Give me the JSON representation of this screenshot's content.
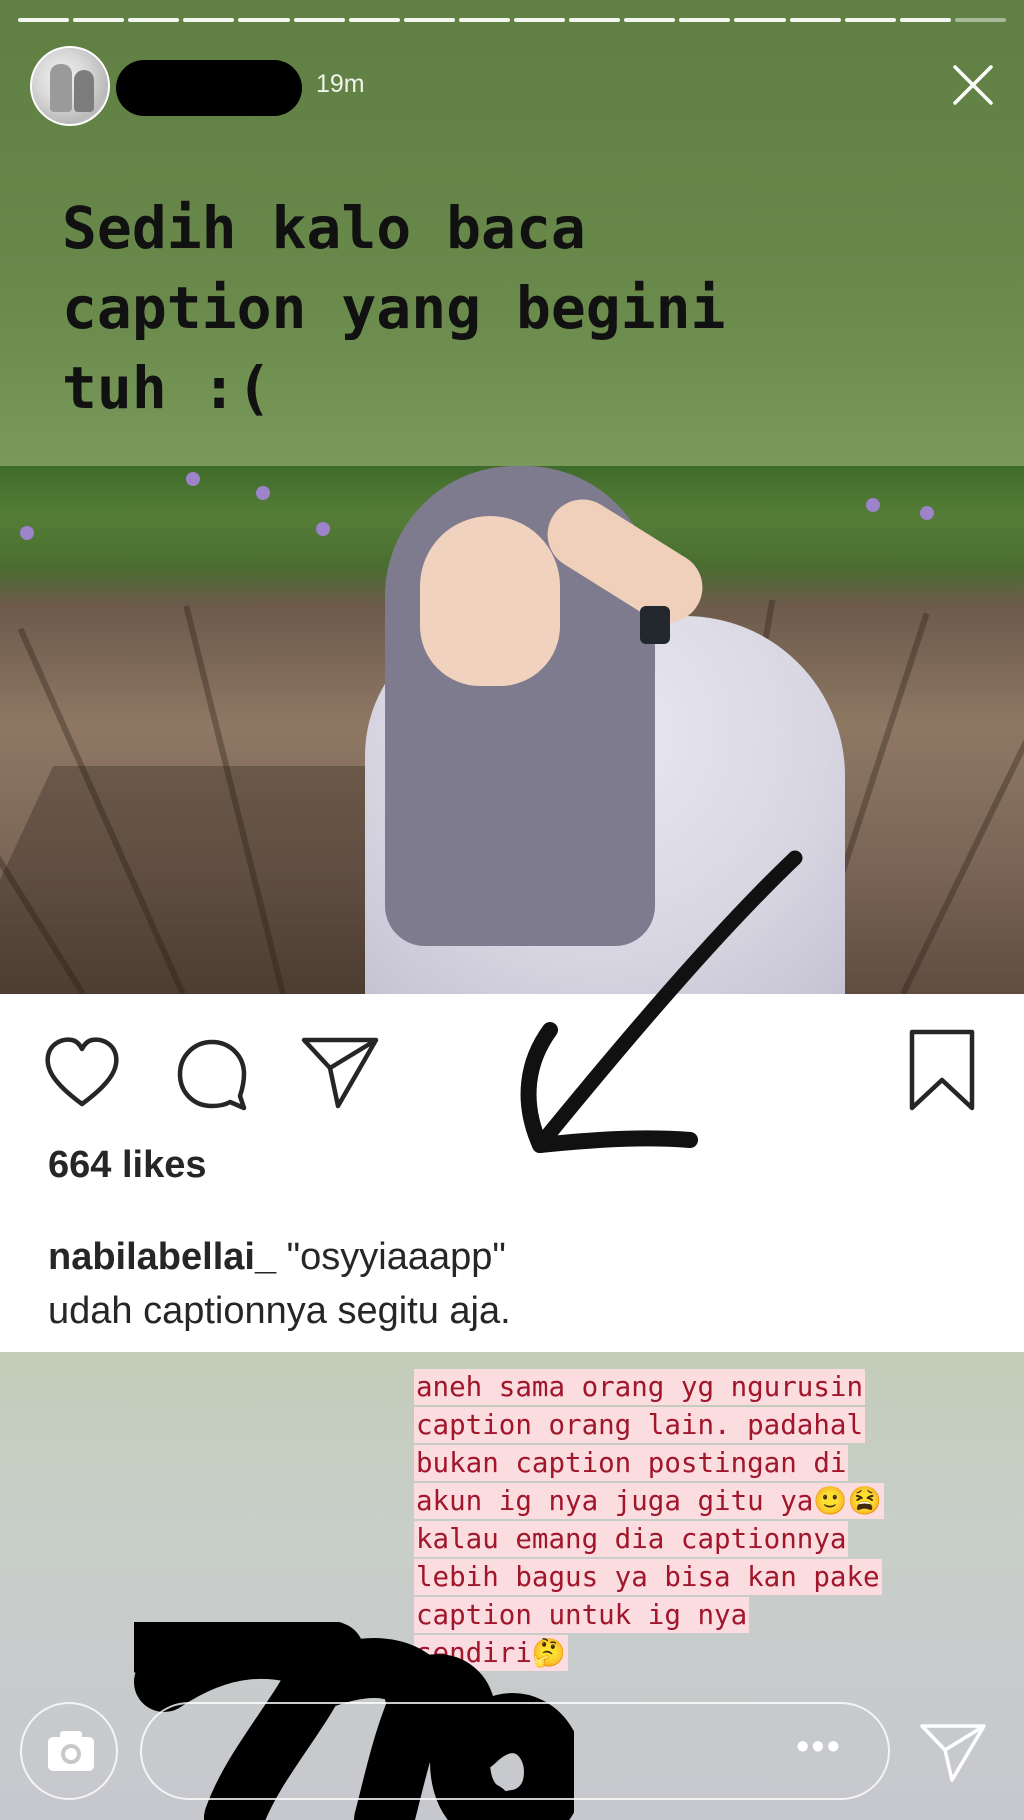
{
  "story": {
    "progress_segments": 18,
    "progress_filled": 17,
    "time_ago": "19m",
    "headline": "Sedih kalo baca\ncaption yang begini\ntuh :(",
    "icons": {
      "close": "close-icon",
      "camera": "camera-icon",
      "more": "more-dots-icon",
      "send": "send-direct-icon"
    }
  },
  "post": {
    "likes": "664 likes",
    "username": "nabilabellai_",
    "caption_text": " \"osyyiaaapp\"",
    "comment": "udah captionnya segitu aja.",
    "icons": [
      "heart-icon",
      "comment-icon",
      "share-icon",
      "bookmark-icon"
    ]
  },
  "note": {
    "lines": [
      "aneh sama orang yg ngurusin",
      "caption orang lain. padahal",
      "bukan caption postingan di",
      "akun ig nya juga gitu ya🙂😫",
      "kalau emang dia captionnya",
      "lebih bagus ya bisa kan pake",
      "caption untuk ig nya",
      "sendiri🤔"
    ]
  },
  "reply": {
    "more_label": "•••"
  },
  "colors": {
    "story_background": "#6a8a4c",
    "note_text": "#a1162b",
    "note_highlight": "#ffdee2",
    "headline_text": "#111111"
  }
}
